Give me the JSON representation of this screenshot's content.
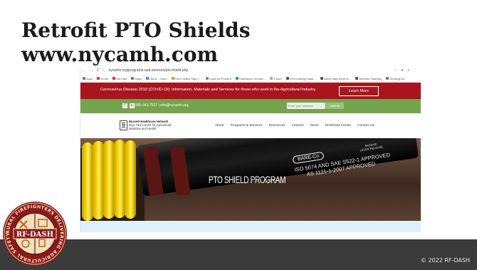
{
  "slide": {
    "title_line1": "Retrofit PTO Shields",
    "title_line2": "www.nycamh.com",
    "copyright": "© 2022 RF-DASH",
    "logo_text": "RF-DASH",
    "logo_ring_text": "RURAL FIREFIGHTERS DELIVERING AGRICULTURAL SAFETY & HEALTH"
  },
  "browser": {
    "url": "nycamh.org/programs-and-services/pto-shield.php",
    "bookmarks": [
      "Apps",
      "Gmail",
      "YouTube",
      "Maps",
      "Home - Zoom",
      "Farm Safety Sign L...",
      "Login for ProMed",
      "Salesforce UN Ban...",
      "iCloud",
      "OHS training mater...",
      "safety data sheet te...",
      "NetSuite Gateway",
      "Reading list"
    ]
  },
  "site": {
    "covid_banner": "Coronavirus Disease 2019 (COVID-19): Information, Materials and Services for those who work in the Agricultural Industry",
    "learn_more": "Learn More",
    "contact": "800-343-7527  |  info@nycamh.org",
    "search_placeholder": "Enter your keyword",
    "search_button": "Search",
    "logo_line1": "Bassett Healthcare Network",
    "logo_line2": "New York Center for Agricultural",
    "logo_line3": "Medicine and Health",
    "nav": [
      "About",
      "Programs & Services",
      "Resources",
      "Careers",
      "News",
      "Northeast Center",
      "Contact Us"
    ],
    "hero_title": "PTO SHIELD PROGRAM",
    "hero_brand": "BARE-Co",
    "hero_approved1": "ISO 5674 AND SAE S522-1 APPROVED",
    "hero_approved2": "AS 1121-1-2007 APPROVED",
    "hero_release1": "PASSIVE",
    "hero_release2": "LEVER RELEASE"
  }
}
